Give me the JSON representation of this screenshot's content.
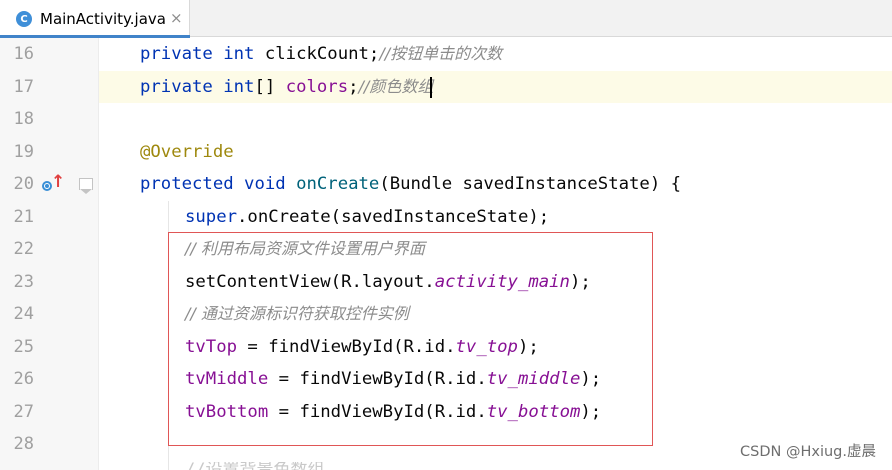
{
  "tab": {
    "title": "MainActivity.java",
    "icon_letter": "C",
    "close_glyph": "×"
  },
  "line_numbers": [
    "16",
    "17",
    "18",
    "19",
    "20",
    "21",
    "22",
    "23",
    "24",
    "25",
    "26",
    "27",
    "28"
  ],
  "code": {
    "l16": {
      "kw1": "private",
      "kw2": "int",
      "rest": " clickCount;",
      "comment": "//按钮单击的次数"
    },
    "l17": {
      "kw1": "private",
      "kw2": "int",
      "brackets": "[] ",
      "field": "colors",
      "semi": ";",
      "comment": "//颜色数组"
    },
    "l19": {
      "annotation": "@Override"
    },
    "l20": {
      "kw1": "protected",
      "kw2": "void",
      "method": "onCreate",
      "rest": "(Bundle savedInstanceState) {"
    },
    "l21": {
      "kw": "super",
      "rest": ".onCreate(savedInstanceState);"
    },
    "l22": {
      "comment": "// 利用布局资源文件设置用户界面"
    },
    "l23": {
      "pre": "setContentView(R.layout.",
      "const": "activity_main",
      "post": ");"
    },
    "l24": {
      "comment": "// 通过资源标识符获取控件实例"
    },
    "l25": {
      "field": "tvTop",
      "pre": " = findViewById(R.id.",
      "const": "tv_top",
      "post": ");"
    },
    "l26": {
      "field": "tvMiddle",
      "pre": " = findViewById(R.id.",
      "const": "tv_middle",
      "post": ");"
    },
    "l27": {
      "field": "tvBottom",
      "pre": " = findViewById(R.id.",
      "const": "tv_bottom",
      "post": ");"
    }
  },
  "partial_next_line": "//设置背景色数组",
  "watermark": "CSDN @Hxiug.虚晨",
  "colors": {
    "keyword": "#0033b3",
    "field": "#871094",
    "annotation": "#9e880d",
    "method": "#00627a",
    "comment": "#8c8c8c",
    "highlight_box": "#e05656",
    "current_line": "#fdfbe7"
  }
}
